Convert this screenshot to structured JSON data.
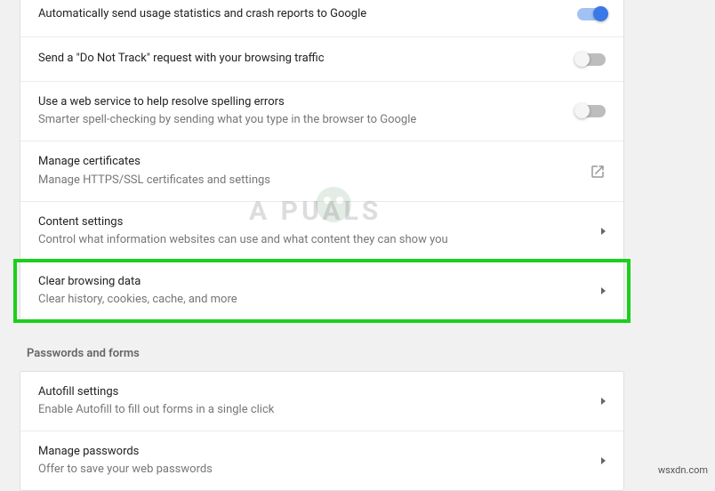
{
  "privacy": {
    "stats": {
      "title": "Automatically send usage statistics and crash reports to Google",
      "enabled": true
    },
    "dnt": {
      "title": "Send a \"Do Not Track\" request with your browsing traffic",
      "enabled": false
    },
    "spell": {
      "title": "Use a web service to help resolve spelling errors",
      "desc": "Smarter spell-checking by sending what you type in the browser to Google",
      "enabled": false
    },
    "certs": {
      "title": "Manage certificates",
      "desc": "Manage HTTPS/SSL certificates and settings"
    },
    "content": {
      "title": "Content settings",
      "desc": "Control what information websites can use and what content they can show you"
    },
    "clear": {
      "title": "Clear browsing data",
      "desc": "Clear history, cookies, cache, and more"
    }
  },
  "section2_title": "Passwords and forms",
  "forms": {
    "autofill": {
      "title": "Autofill settings",
      "desc": "Enable Autofill to fill out forms in a single click"
    },
    "passwords": {
      "title": "Manage passwords",
      "desc": "Offer to save your web passwords"
    }
  },
  "watermark": "A  PUALS",
  "attribution": "wsxdn.com"
}
